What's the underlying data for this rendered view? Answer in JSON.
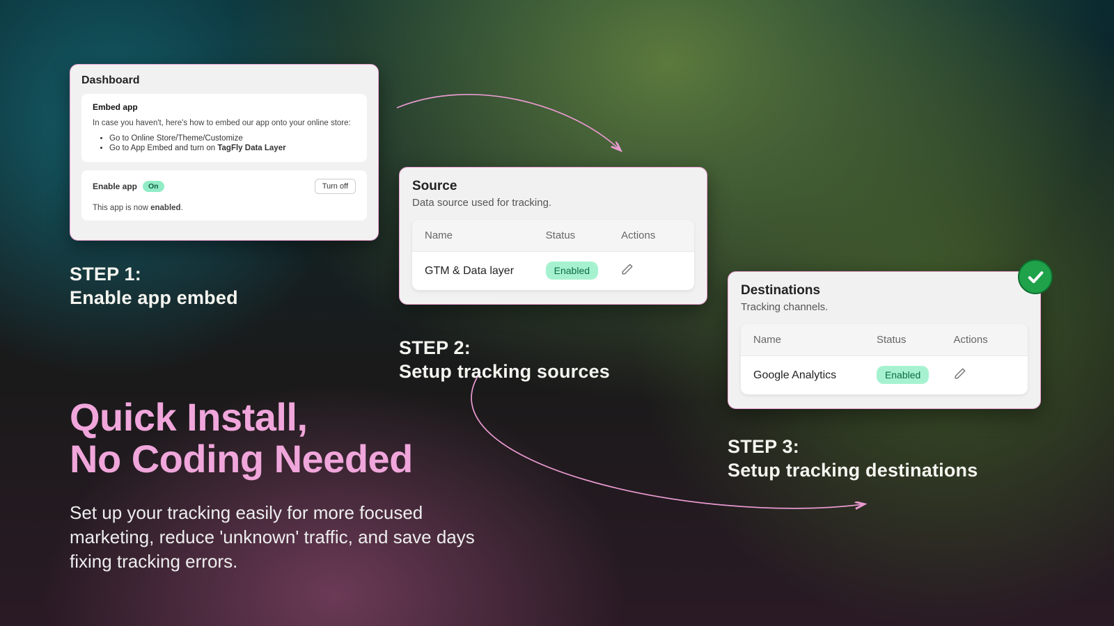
{
  "card1": {
    "title": "Dashboard",
    "embed": {
      "heading": "Embed app",
      "intro": "In case you haven't, here's how to embed our app onto your online store:",
      "bullet1": "Go to Online Store/Theme/Customize",
      "bullet2_prefix": "Go to App Embed and turn on ",
      "bullet2_bold": "TagFly Data Layer"
    },
    "enable": {
      "label": "Enable app",
      "badge": "On",
      "button": "Turn off",
      "status_prefix": "This app is now ",
      "status_bold": "enabled",
      "status_suffix": "."
    }
  },
  "step1": {
    "line1": "STEP 1:",
    "line2": "Enable app embed"
  },
  "card2": {
    "title": "Source",
    "subtitle": "Data source used for tracking.",
    "cols": {
      "name": "Name",
      "status": "Status",
      "actions": "Actions"
    },
    "row": {
      "name": "GTM & Data layer",
      "status": "Enabled"
    }
  },
  "step2": {
    "line1": "STEP 2:",
    "line2": "Setup tracking sources"
  },
  "card3": {
    "title": "Destinations",
    "subtitle": "Tracking channels.",
    "cols": {
      "name": "Name",
      "status": "Status",
      "actions": "Actions"
    },
    "row": {
      "name": "Google Analytics",
      "status": "Enabled"
    }
  },
  "step3": {
    "line1": "STEP 3:",
    "line2": "Setup tracking destinations"
  },
  "headline": {
    "l1": "Quick Install,",
    "l2": "No Coding Needed",
    "sub": "Set up your tracking easily for more focused marketing, reduce 'unknown' traffic, and save days fixing tracking errors."
  }
}
